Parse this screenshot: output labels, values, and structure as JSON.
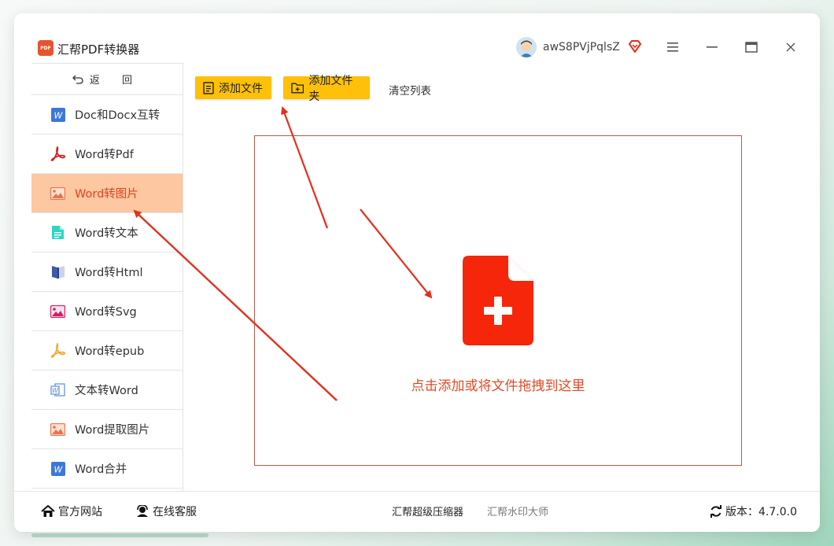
{
  "app": {
    "title": "汇帮PDF转换器",
    "logo_text": "PDF",
    "username": "awS8PVjPqlsZ"
  },
  "sidebar": {
    "back_label": "返 回",
    "items": [
      {
        "label": "Doc和Docx互转",
        "icon": "word-doc-icon"
      },
      {
        "label": "Word转Pdf",
        "icon": "pdf-icon"
      },
      {
        "label": "Word转图片",
        "icon": "image-icon"
      },
      {
        "label": "Word转文本",
        "icon": "text-file-icon"
      },
      {
        "label": "Word转Html",
        "icon": "html-book-icon"
      },
      {
        "label": "Word转Svg",
        "icon": "svg-image-icon"
      },
      {
        "label": "Word转epub",
        "icon": "epub-icon"
      },
      {
        "label": "文本转Word",
        "icon": "word-outline-icon"
      },
      {
        "label": "Word提取图片",
        "icon": "extract-image-icon"
      },
      {
        "label": "Word合并",
        "icon": "word-merge-icon"
      }
    ],
    "active_index": 2
  },
  "toolbar": {
    "add_file": "添加文件",
    "add_folder": "添加文件夹",
    "clear_list": "清空列表"
  },
  "dropzone": {
    "text": "点击添加或将文件拖拽到这里"
  },
  "statusbar": {
    "website": "官方网站",
    "service": "在线客服",
    "compressor": "汇帮超级压缩器",
    "watermark": "汇帮水印大师",
    "version_label": "版本：4.7.0.0"
  },
  "colors": {
    "accent": "#ffc107",
    "active_bg": "#fcc7a1",
    "active_text": "#e14321",
    "drop_icon": "#f5260a",
    "arrow": "#e2311e"
  }
}
